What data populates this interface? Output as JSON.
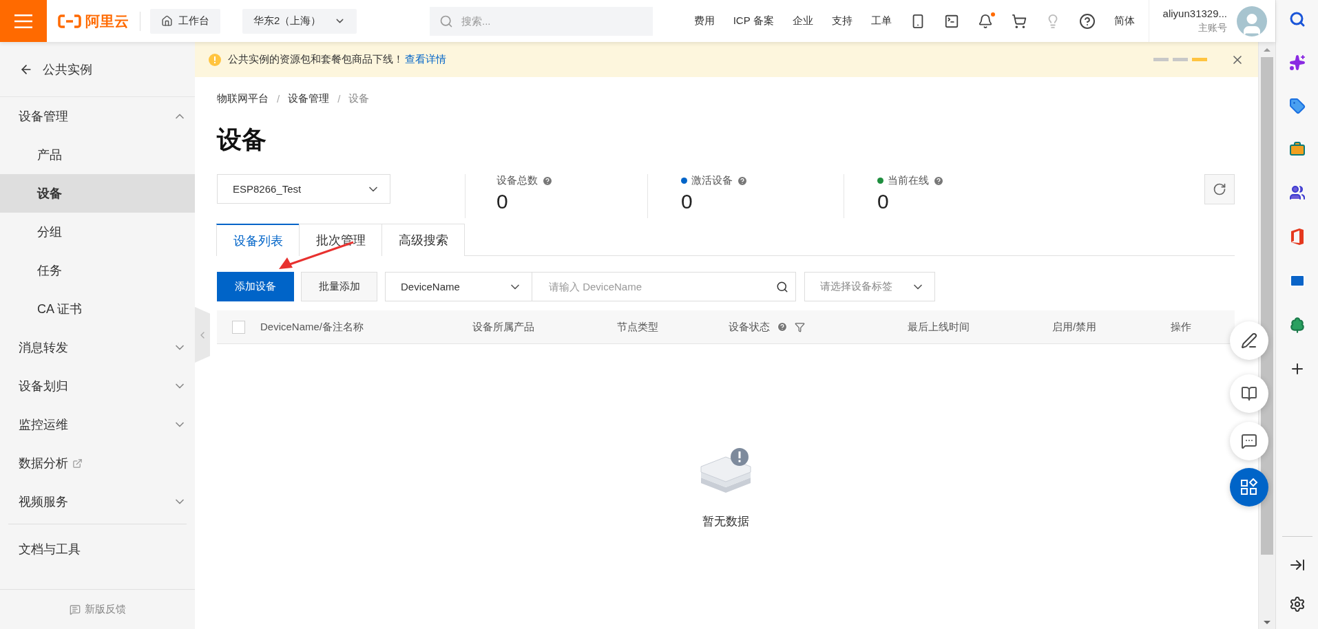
{
  "top_bar": {
    "logo": "阿里云",
    "workbench": "工作台",
    "region": "华东2（上海）",
    "search": {
      "placeholder": "搜索..."
    },
    "nav_links": [
      "费用",
      "ICP 备案",
      "企业",
      "支持",
      "工单"
    ],
    "notifications_unread": true,
    "language": "简体",
    "user": {
      "name": "aliyun31329...",
      "role": "主账号"
    }
  },
  "notice": {
    "text": "公共实例的资源包和套餐包商品下线！",
    "link": "查看详情",
    "pager": [
      {
        "selected": false
      },
      {
        "selected": false
      },
      {
        "selected": true
      }
    ]
  },
  "sidebar": {
    "back": "公共实例",
    "items": [
      {
        "label": "设备管理",
        "kind": "group",
        "expanded": true,
        "selected": false,
        "children": [
          {
            "label": "产品",
            "selected": false
          },
          {
            "label": "设备",
            "selected": true
          },
          {
            "label": "分组",
            "selected": false
          },
          {
            "label": "任务",
            "selected": false
          },
          {
            "label": "CA 证书",
            "selected": false
          }
        ]
      },
      {
        "label": "消息转发",
        "kind": "group",
        "expanded": false,
        "selected": false
      },
      {
        "label": "设备划归",
        "kind": "group",
        "expanded": false,
        "selected": false
      },
      {
        "label": "监控运维",
        "kind": "group",
        "expanded": false,
        "selected": false
      },
      {
        "label": "数据分析",
        "kind": "external",
        "selected": false
      },
      {
        "label": "视频服务",
        "kind": "group",
        "expanded": false,
        "selected": false
      }
    ],
    "footer_link": "文档与工具",
    "feedback": "新版反馈"
  },
  "main": {
    "breadcrumb": [
      "物联网平台",
      "设备管理",
      "设备"
    ],
    "breadcrumb_separator": "/",
    "title": "设备",
    "product_select": "ESP8266_Test",
    "stats": [
      {
        "label": "设备总数",
        "value": "0"
      },
      {
        "label": "激活设备",
        "value": "0",
        "color": "#0064c8"
      },
      {
        "label": "当前在线",
        "value": "0",
        "color": "#1e8e3e"
      }
    ],
    "tabs": [
      {
        "label": "设备列表",
        "selected": true
      },
      {
        "label": "批次管理",
        "selected": false
      },
      {
        "label": "高级搜索",
        "selected": false
      }
    ],
    "toolbar": {
      "primary": "添加设备",
      "secondary": "批量添加",
      "field_select": "DeviceName",
      "search": {
        "placeholder": "请输入 DeviceName"
      },
      "tag_select": {
        "placeholder": "请选择设备标签"
      }
    },
    "table": {
      "select_all": {
        "checked": false
      },
      "columns": [
        {
          "label": "DeviceName/备注名称"
        },
        {
          "label": "设备所属产品"
        },
        {
          "label": "节点类型"
        },
        {
          "label": "设备状态",
          "help": true,
          "filter": true
        },
        {
          "label": "最后上线时间"
        },
        {
          "label": "启用/禁用"
        },
        {
          "label": "操作"
        }
      ],
      "empty_text": "暂无数据"
    }
  }
}
